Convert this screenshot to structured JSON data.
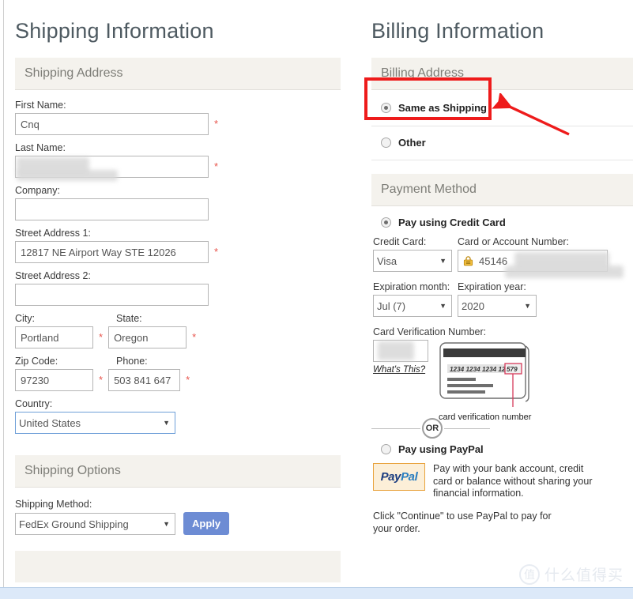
{
  "shipping": {
    "title": "Shipping Information",
    "address_section": "Shipping Address",
    "fields": {
      "first_name_label": "First Name:",
      "first_name_value": "Cnq",
      "last_name_label": "Last Name:",
      "last_name_value": "",
      "company_label": "Company:",
      "company_value": "",
      "street1_label": "Street Address 1:",
      "street1_value": "12817 NE Airport Way STE 12026",
      "street2_label": "Street Address 2:",
      "street2_value": "",
      "city_label": "City:",
      "city_value": "Portland",
      "state_label": "State:",
      "state_value": "Oregon",
      "zip_label": "Zip Code:",
      "zip_value": "97230",
      "phone_label": "Phone:",
      "phone_value": "503 841 647",
      "country_label": "Country:",
      "country_value": "United States"
    },
    "options_section": "Shipping Options",
    "method_label": "Shipping Method:",
    "method_value": "FedEx Ground Shipping",
    "apply_label": "Apply"
  },
  "billing": {
    "title": "Billing Information",
    "address_section": "Billing Address",
    "same_as_shipping": "Same as Shipping",
    "other": "Other",
    "payment_section": "Payment Method",
    "pay_credit_card": "Pay using Credit Card",
    "credit_card_label": "Credit Card:",
    "credit_card_value": "Visa",
    "card_number_label": "Card or Account Number:",
    "card_number_value": "45146",
    "exp_month_label": "Expiration month:",
    "exp_month_value": "Jul (7)",
    "exp_year_label": "Expiration year:",
    "exp_year_value": "2020",
    "cvn_label": "Card Verification Number:",
    "cvn_value": "",
    "whats_this": "What's This?",
    "card_digits": "1234 1234 1234 1234",
    "card_cvn_digits": "579",
    "card_caption": "card verification number",
    "or_divider": "OR",
    "pay_paypal": "Pay using PayPal",
    "paypal_logo_pay": "Pay",
    "paypal_logo_pal": "Pal",
    "paypal_desc": "Pay with your bank account, credit card or balance without sharing your financial information.",
    "paypal_note": "Click \"Continue\" to use PayPal to pay for your order."
  },
  "annotations": {
    "required_marker": "*"
  },
  "watermark": {
    "glyph": "值",
    "text": "什么值得买"
  },
  "colors": {
    "annotation_red": "#ee1b1b",
    "section_bg": "#f4f2ed",
    "apply_blue": "#6d8cd4",
    "required_red": "#e8554d"
  }
}
